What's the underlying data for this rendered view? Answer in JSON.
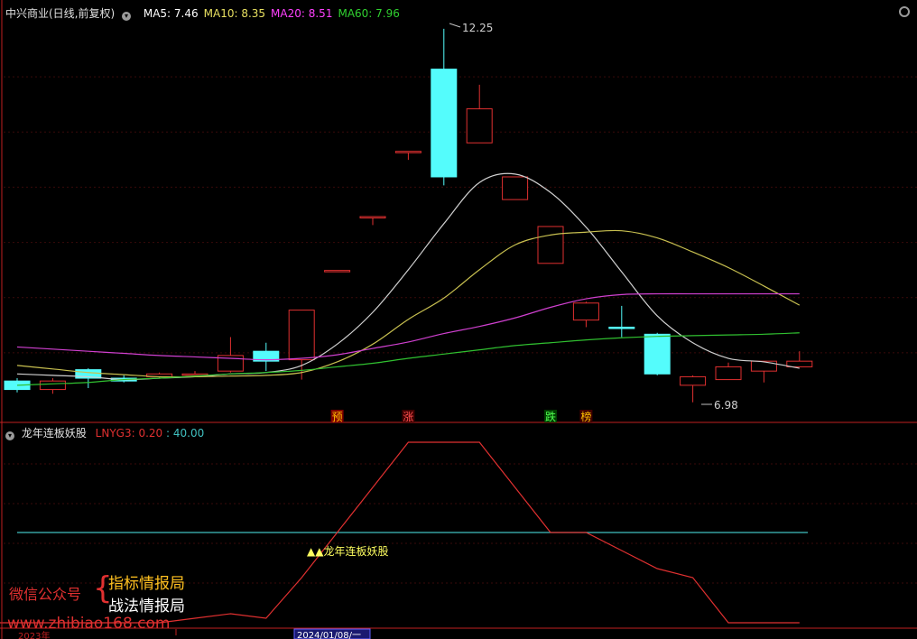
{
  "header": {
    "stock_title": "中兴商业(日线,前复权)",
    "ma": [
      {
        "label": "MA5: 7.46",
        "color": "#ffffff"
      },
      {
        "label": "MA10: 8.35",
        "color": "#e8e060"
      },
      {
        "label": "MA20: 8.51",
        "color": "#ff40ff"
      },
      {
        "label": "MA60: 7.96",
        "color": "#30d030"
      }
    ]
  },
  "indicator": {
    "name": "龙年连板妖股",
    "lnyg3_label": "LNYG3: 0.20",
    "value_label": ": 40.00",
    "signal_label": "▲▲龙年连板妖股"
  },
  "watermark": {
    "wechat": "微信公众号",
    "line1": "指标情报局",
    "line2": "战法情报局",
    "url": "www.zhibiao168.com"
  },
  "xaxis": {
    "year": "2023年",
    "cursor_date": "2024/01/08/一"
  },
  "markers": [
    {
      "text": "预",
      "color": "#ffc000",
      "bg": "#800000"
    },
    {
      "text": "涨",
      "color": "#ff5050",
      "bg": "#400000"
    },
    {
      "text": "跌",
      "color": "#50ff50",
      "bg": "#004000"
    },
    {
      "text": "榜",
      "color": "#ffc000",
      "bg": "#400000"
    }
  ],
  "chart_data": {
    "type": "candlestick",
    "price_max_label": "12.25",
    "price_min_label": "6.98",
    "candles": [
      {
        "o": 7.28,
        "c": 7.16,
        "h": 7.32,
        "l": 7.12
      },
      {
        "o": 7.16,
        "c": 7.28,
        "h": 7.32,
        "l": 7.1
      },
      {
        "o": 7.44,
        "c": 7.32,
        "h": 7.46,
        "l": 7.18
      },
      {
        "o": 7.32,
        "c": 7.28,
        "h": 7.36,
        "l": 7.26
      },
      {
        "o": 7.34,
        "c": 7.38,
        "h": 7.4,
        "l": 7.32
      },
      {
        "o": 7.36,
        "c": 7.38,
        "h": 7.42,
        "l": 7.34
      },
      {
        "o": 7.42,
        "c": 7.64,
        "h": 7.9,
        "l": 7.4
      },
      {
        "o": 7.7,
        "c": 7.56,
        "h": 7.82,
        "l": 7.42
      },
      {
        "o": 7.58,
        "c": 8.28,
        "h": 8.28,
        "l": 7.3
      },
      {
        "o": 8.84,
        "c": 8.84,
        "h": 8.84,
        "l": 8.84
      },
      {
        "o": 9.6,
        "c": 9.6,
        "h": 9.6,
        "l": 9.48
      },
      {
        "o": 10.52,
        "c": 10.52,
        "h": 10.52,
        "l": 10.4
      },
      {
        "o": 11.68,
        "c": 10.16,
        "h": 12.25,
        "l": 10.04
      },
      {
        "o": 10.64,
        "c": 11.12,
        "h": 11.46,
        "l": 10.64
      },
      {
        "o": 9.84,
        "c": 10.16,
        "h": 9.94,
        "l": 9.84
      },
      {
        "o": 8.94,
        "c": 9.46,
        "h": 9.46,
        "l": 8.94
      },
      {
        "o": 8.14,
        "c": 8.38,
        "h": 8.4,
        "l": 8.04
      },
      {
        "o": 8.04,
        "c": 8.02,
        "h": 8.34,
        "l": 7.9
      },
      {
        "o": 7.94,
        "c": 7.38,
        "h": 7.96,
        "l": 7.36
      },
      {
        "o": 7.22,
        "c": 7.34,
        "h": 7.36,
        "l": 6.98
      },
      {
        "o": 7.3,
        "c": 7.48,
        "h": 7.54,
        "l": 7.3
      },
      {
        "o": 7.42,
        "c": 7.56,
        "h": 7.56,
        "l": 7.26
      },
      {
        "o": 7.48,
        "c": 7.56,
        "h": 7.7,
        "l": 7.48
      }
    ],
    "ma_series": [
      {
        "name": "MA5",
        "color": "#d0d0d0",
        "values": [
          7.38,
          7.36,
          7.34,
          7.3,
          7.32,
          7.34,
          7.38,
          7.4,
          7.5,
          7.8,
          8.25,
          8.85,
          9.5,
          10.08,
          10.2,
          9.94,
          9.45,
          8.82,
          8.2,
          7.82,
          7.6,
          7.55,
          7.46
        ]
      },
      {
        "name": "MA10",
        "color": "#c8c050",
        "values": [
          7.5,
          7.45,
          7.4,
          7.37,
          7.34,
          7.34,
          7.35,
          7.36,
          7.4,
          7.55,
          7.8,
          8.15,
          8.45,
          8.85,
          9.2,
          9.34,
          9.38,
          9.4,
          9.3,
          9.1,
          8.88,
          8.62,
          8.35
        ]
      },
      {
        "name": "MA20",
        "color": "#d040d0",
        "values": [
          7.76,
          7.73,
          7.7,
          7.67,
          7.64,
          7.62,
          7.6,
          7.58,
          7.6,
          7.65,
          7.74,
          7.83,
          7.95,
          8.05,
          8.17,
          8.32,
          8.44,
          8.5,
          8.51,
          8.51,
          8.51,
          8.51,
          8.51
        ]
      },
      {
        "name": "MA60",
        "color": "#30c030",
        "values": [
          7.22,
          7.24,
          7.26,
          7.3,
          7.32,
          7.35,
          7.38,
          7.4,
          7.43,
          7.48,
          7.53,
          7.6,
          7.66,
          7.72,
          7.78,
          7.82,
          7.86,
          7.89,
          7.91,
          7.92,
          7.93,
          7.94,
          7.96
        ]
      }
    ],
    "indicator_series": [
      {
        "name": "LNYG3",
        "color": "#e03030",
        "values": [
          0,
          0,
          0,
          0,
          0,
          2,
          4,
          2,
          20,
          40,
          60,
          80,
          80,
          80,
          60,
          40,
          40,
          32,
          24,
          20,
          0,
          0,
          0
        ]
      },
      {
        "name": "value",
        "color": "#40c0c0",
        "values": [
          40,
          40,
          40,
          40,
          40,
          40,
          40,
          40,
          40,
          40,
          40,
          40,
          40,
          40,
          40,
          40,
          40,
          40,
          40,
          40,
          40,
          40,
          40
        ]
      }
    ],
    "indicator_range": [
      0,
      80
    ]
  }
}
